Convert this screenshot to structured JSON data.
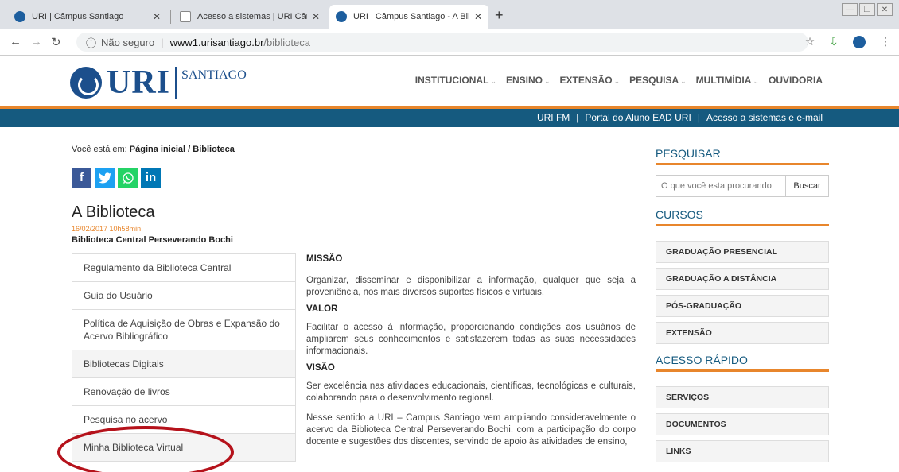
{
  "browser": {
    "tabs": [
      {
        "label": "URI | Câmpus Santiago",
        "icon_color": "#1d5e9e",
        "active": false
      },
      {
        "label": "Acesso a sistemas | URI Câmpus Sa",
        "icon_color": "#ffffff",
        "active": false
      },
      {
        "label": "URI | Câmpus Santiago - A Bibliotec",
        "icon_color": "#1d5e9e",
        "active": true
      }
    ],
    "close_glyph": "✕",
    "new_tab_glyph": "+",
    "secure_label": "Não seguro",
    "url_host": "www1.urisantiago.br",
    "url_path": "/biblioteca"
  },
  "site": {
    "logo_text": "URI",
    "logo_sub": "SANTIAGO",
    "nav": [
      {
        "label": "INSTITUCIONAL",
        "dropdown": true
      },
      {
        "label": "ENSINO",
        "dropdown": true
      },
      {
        "label": "EXTENSÃO",
        "dropdown": true
      },
      {
        "label": "PESQUISA",
        "dropdown": true
      },
      {
        "label": "MULTIMÍDIA",
        "dropdown": true
      },
      {
        "label": "OUVIDORIA",
        "dropdown": false
      }
    ],
    "top_links": [
      "URI FM",
      "Portal do Aluno EAD URI",
      "Acesso a sistemas e e-mail"
    ],
    "top_links_separator": "|"
  },
  "breadcrumb": {
    "prefix": "Você está em:",
    "path": "Página inicial / Biblioteca"
  },
  "social": [
    "f",
    "t",
    "w",
    "in"
  ],
  "page": {
    "title": "A Biblioteca",
    "date": "16/02/2017 10h58min",
    "subtitle": "Biblioteca Central Perseverando Bochi"
  },
  "left_menu": [
    {
      "label": "Regulamento da Biblioteca Central",
      "shaded": false
    },
    {
      "label": "Guia do Usuário",
      "shaded": false
    },
    {
      "label": "Política de Aquisição de Obras e Expansão do Acervo Bibliográfico",
      "shaded": false
    },
    {
      "label": "Bibliotecas Digitais",
      "shaded": true
    },
    {
      "label": "Renovação de livros",
      "shaded": false
    },
    {
      "label": "Pesquisa no acervo",
      "shaded": false
    },
    {
      "label": "Minha Biblioteca Virtual",
      "shaded": true
    }
  ],
  "content": {
    "missao_title": "MISSÃO",
    "missao_text": "Organizar, disseminar e disponibilizar a informação, qualquer que seja a proveniência, nos mais diversos suportes físicos e virtuais.",
    "valor_title": "VALOR",
    "valor_text": "Facilitar o acesso à informação, proporcionando condições aos usuários de ampliarem seus conhecimentos e satisfazerem todas as suas necessidades informacionais.",
    "visao_title": "VISÃO",
    "visao_text": "Ser excelência nas atividades educacionais, científicas, tecnológicas e culturais, colaborando para o desenvolvimento regional.",
    "extra_text": "Nesse sentido a URI – Campus Santiago vem ampliando consideravelmente o acervo da Biblioteca Central Perseverando Bochi, com a participação do corpo docente e sugestões dos discentes, servindo de apoio às atividades de ensino,"
  },
  "sidebar": {
    "search_heading": "PESQUISAR",
    "search_placeholder": "O que você esta procurando",
    "search_button": "Buscar",
    "cursos_heading": "CURSOS",
    "cursos": [
      "GRADUAÇÃO PRESENCIAL",
      "GRADUAÇÃO A DISTÂNCIA",
      "PÓS-GRADUAÇÃO",
      "EXTENSÃO"
    ],
    "acesso_heading": "ACESSO RÁPIDO",
    "acesso": [
      "SERVIÇOS",
      "DOCUMENTOS",
      "LINKS"
    ]
  },
  "colors": {
    "brand_blue": "#155a7f",
    "accent_orange": "#e8862c",
    "annotation_red": "#b5121b"
  }
}
